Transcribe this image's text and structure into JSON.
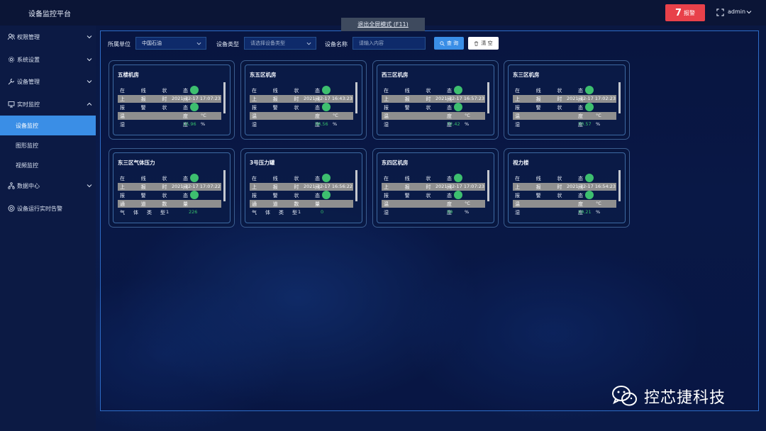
{
  "app": {
    "title": "设备监控平台"
  },
  "header": {
    "alarm_count": "7",
    "alarm_label": "报警",
    "user": "admin"
  },
  "sidebar": {
    "items": [
      {
        "label": "权限管理",
        "icon": "users-icon",
        "expandable": true
      },
      {
        "label": "系统设置",
        "icon": "gear-icon",
        "expandable": true
      },
      {
        "label": "设备管理",
        "icon": "wrench-icon",
        "expandable": true
      },
      {
        "label": "实时监控",
        "icon": "monitor-icon",
        "expandable": true,
        "expanded": true
      },
      {
        "label": "数据中心",
        "icon": "network-icon",
        "expandable": true
      },
      {
        "label": "设备运行实时告警",
        "icon": "alert-circle-icon",
        "expandable": false
      }
    ],
    "sub_items": [
      {
        "label": "设备监控",
        "active": true
      },
      {
        "label": "图形监控",
        "active": false
      },
      {
        "label": "视频监控",
        "active": false
      }
    ]
  },
  "exit_fullscreen": "退出全屏模式 (F11)",
  "filters": {
    "unit_label": "所属单位",
    "unit_value": "中国石油",
    "type_label": "设备类型",
    "type_placeholder": "请选择设备类型",
    "name_label": "设备名称",
    "name_placeholder": "请输入内容",
    "query_label": "查 询",
    "clear_label": "清 空"
  },
  "labels": {
    "online": [
      "在",
      "线",
      "状",
      "态"
    ],
    "report": [
      "上",
      "报",
      "时",
      "间"
    ],
    "alarm": [
      "报",
      "警",
      "状",
      "态"
    ],
    "temp": [
      "温",
      "度"
    ],
    "humidity": [
      "湿",
      "度"
    ],
    "channels": [
      "通",
      "道",
      "数",
      "量"
    ],
    "gas_type": [
      "气",
      "体",
      "类",
      "型"
    ],
    "unit_c": "°C",
    "unit_pct": "%"
  },
  "devices": [
    {
      "name": "五楼机房",
      "kind": "env",
      "online_color": "#3dbf6f",
      "report_time": "2021-12-17 17:07:23",
      "alarm_color": "#3dbf6f",
      "temp": "",
      "humidity": "15.96"
    },
    {
      "name": "东五区机房",
      "kind": "env",
      "online_color": "#3dbf6f",
      "report_time": "2021-12-17 16:43:23",
      "alarm_color": "#3dbf6f",
      "temp": "",
      "humidity": "58.56"
    },
    {
      "name": "西三区机房",
      "kind": "env",
      "online_color": "#3dbf6f",
      "report_time": "2021-12-17 16:57:23",
      "alarm_color": "#3dbf6f",
      "temp": "",
      "humidity": "72.42"
    },
    {
      "name": "东三区机房",
      "kind": "env",
      "online_color": "#3dbf6f",
      "report_time": "2021-12-17 17:02:23",
      "alarm_color": "#3dbf6f",
      "temp": "",
      "humidity": "70.57"
    },
    {
      "name": "东三区气体压力",
      "kind": "gas",
      "online_color": "#3dbf6f",
      "report_time": "2021-12-17 17:07:22",
      "alarm_color": "#3dbf6f",
      "channels": "",
      "gas_type_value": "1",
      "gas_reading": "226"
    },
    {
      "name": "3号压力罐",
      "kind": "gas",
      "online_color": "#3dbf6f",
      "report_time": "2021-12-17 16:56:22",
      "alarm_color": "#3dbf6f",
      "channels": "",
      "gas_type_value": "1",
      "gas_reading": "0"
    },
    {
      "name": "东四区机房",
      "kind": "env",
      "online_color": "#3dbf6f",
      "report_time": "2021-12-17 17:07:23",
      "alarm_color": "#3dbf6f",
      "temp": "",
      "humidity": "59"
    },
    {
      "name": "视力楼",
      "kind": "env",
      "online_color": "#3dbf6f",
      "report_time": "2021-12-17 16:54:23",
      "alarm_color": "#3dbf6f",
      "temp": "",
      "humidity": "19.21"
    }
  ],
  "watermark": {
    "text": "控芯捷科技"
  },
  "colors": {
    "accent": "#3a8ee6",
    "alarm": "#e8414a",
    "ok": "#3dbf6f",
    "highlight_row": "#8f8f8f"
  }
}
